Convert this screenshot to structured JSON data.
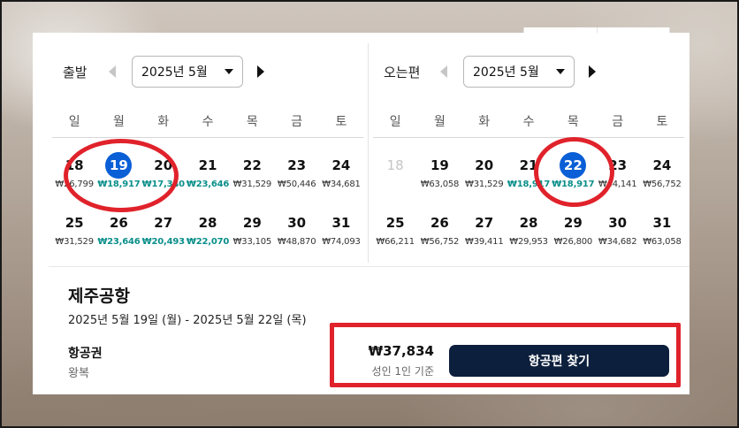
{
  "depart": {
    "title": "출발",
    "month": "2025년 5월",
    "weekdays": [
      "일",
      "월",
      "화",
      "수",
      "목",
      "금",
      "토"
    ],
    "weeks": [
      [
        {
          "day": "18",
          "price": "₩26,799"
        },
        {
          "day": "19",
          "price": "₩18,917",
          "cheap": true,
          "selected": true
        },
        {
          "day": "20",
          "price": "₩17,340",
          "cheap": true
        },
        {
          "day": "21",
          "price": "₩23,646",
          "cheap": true
        },
        {
          "day": "22",
          "price": "₩31,529"
        },
        {
          "day": "23",
          "price": "₩50,446"
        },
        {
          "day": "24",
          "price": "₩34,681"
        }
      ],
      [
        {
          "day": "25",
          "price": "₩31,529"
        },
        {
          "day": "26",
          "price": "₩23,646",
          "cheap": true
        },
        {
          "day": "27",
          "price": "₩20,493",
          "cheap": true
        },
        {
          "day": "28",
          "price": "₩22,070",
          "cheap": true
        },
        {
          "day": "29",
          "price": "₩33,105"
        },
        {
          "day": "30",
          "price": "₩48,870"
        },
        {
          "day": "31",
          "price": "₩74,093"
        }
      ]
    ]
  },
  "return": {
    "title": "오는편",
    "month": "2025년 5월",
    "weekdays": [
      "일",
      "월",
      "화",
      "수",
      "목",
      "금",
      "토"
    ],
    "weeks": [
      [
        {
          "day": "18",
          "price": "",
          "disabled": true
        },
        {
          "day": "19",
          "price": "₩63,058"
        },
        {
          "day": "20",
          "price": "₩31,529"
        },
        {
          "day": "21",
          "price": "₩18,917",
          "cheap": true
        },
        {
          "day": "22",
          "price": "₩18,917",
          "cheap": true,
          "selected": true
        },
        {
          "day": "23",
          "price": "₩44,141"
        },
        {
          "day": "24",
          "price": "₩56,752"
        }
      ],
      [
        {
          "day": "25",
          "price": "₩66,211"
        },
        {
          "day": "26",
          "price": "₩56,752"
        },
        {
          "day": "27",
          "price": "₩39,411"
        },
        {
          "day": "28",
          "price": "₩29,953"
        },
        {
          "day": "29",
          "price": "₩26,800"
        },
        {
          "day": "30",
          "price": "₩34,682"
        },
        {
          "day": "31",
          "price": "₩63,058"
        }
      ]
    ]
  },
  "summary": {
    "destination": "제주공항",
    "date_range": "2025년 5월 19일 (월) - 2025년 5월 22일 (목)",
    "ticket_label": "항공권",
    "trip_type": "왕복",
    "total_price": "₩37,834",
    "price_note": "성인 1인 기준",
    "search_button": "항공편 찾기"
  },
  "colors": {
    "selected": "#0a5fd6",
    "cheap_price": "#0a8f8a",
    "annotation_red": "#e0222b",
    "button_bg": "#0c1f3c"
  }
}
